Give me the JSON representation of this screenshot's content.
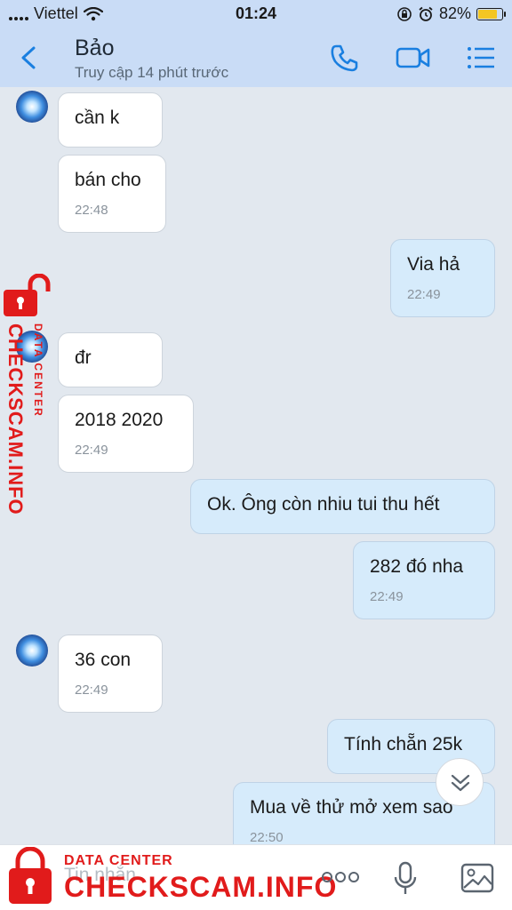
{
  "status_bar": {
    "carrier": "Viettel",
    "time": "01:24",
    "battery": "82%",
    "battery_level": 0.82
  },
  "header": {
    "name": "Bảo",
    "status": "Truy cập 14 phút trước"
  },
  "messages": [
    {
      "text": "cần k"
    },
    {
      "text": "bán cho",
      "time": "22:48"
    },
    {
      "text": "Via hả",
      "time": "22:49"
    },
    {
      "text": "đr"
    },
    {
      "text": "2018 2020",
      "time": "22:49"
    },
    {
      "text": "Ok. Ông còn nhiu tui thu hết"
    },
    {
      "text": "282 đó nha",
      "time": "22:49"
    },
    {
      "text": "36 con",
      "time": "22:49"
    },
    {
      "text": "Tính chẵn 25k"
    },
    {
      "text": "Mua về thử mở xem sao",
      "time": "22:50"
    }
  ],
  "composer": {
    "placeholder": "Tin nhắn"
  },
  "watermark": {
    "side_small": "DATA CENTER",
    "side_big": "CHECKSCAM.INFO",
    "bottom_small": "DATA CENTER",
    "bottom_big": "CHECKSCAM.INFO"
  },
  "colors": {
    "header_bg": "#c9dcf6",
    "chat_bg": "#e2e8ef",
    "incoming": "#ffffff",
    "outgoing": "#d6ebfb",
    "accent": "#1a7fe0",
    "watermark": "#e11b1b"
  }
}
